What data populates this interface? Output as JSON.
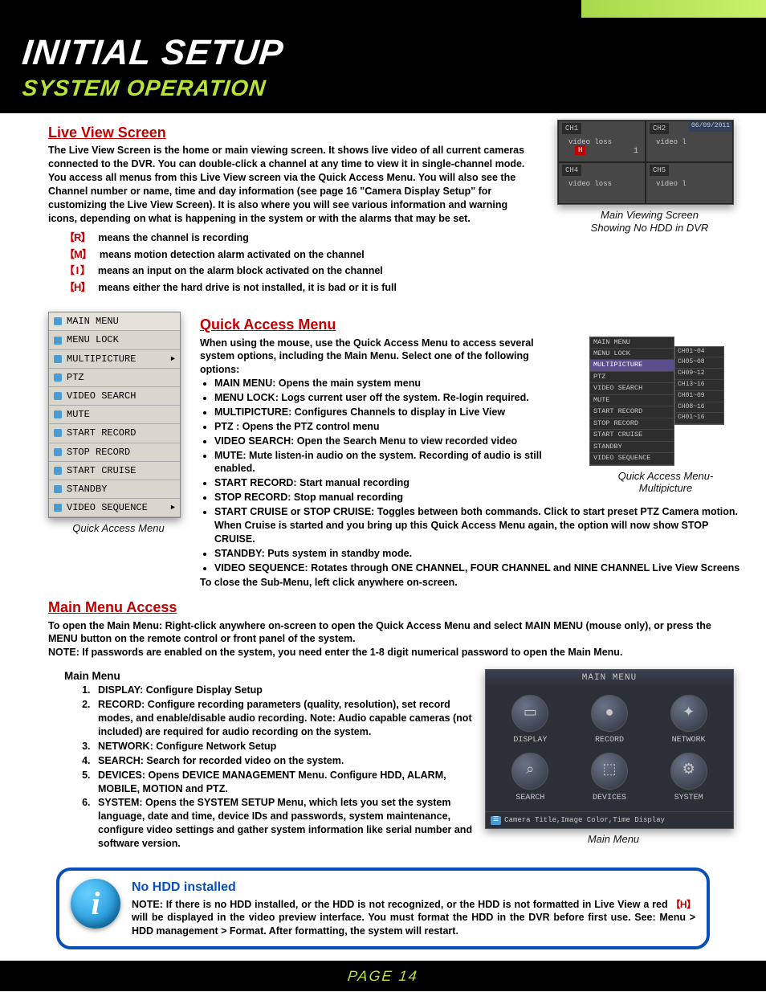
{
  "header": {
    "title": "INITIAL SETUP",
    "subtitle": "SYSTEM OPERATION"
  },
  "live_view": {
    "heading": "Live View Screen",
    "body": "The Live View Screen is the home or main viewing screen. It shows live video of all current cameras connected to the DVR. You can double-click a channel at any time to view it in single-channel mode. You access all menus from this Live View screen via the Quick Access Menu. You will also see the Channel number or name, time and day information (see page 16 \"Camera Display Setup\" for customizing the Live View Screen). It is also where you will see various information and warning icons, depending on what is happening in the system or with the alarms that may be set.",
    "icons": [
      {
        "chip": "【R】",
        "desc": "means the channel is recording"
      },
      {
        "chip": "【M】",
        "desc": "means motion detection alarm activated on the channel"
      },
      {
        "chip": "【 I 】",
        "desc": "means an input on the alarm block activated on the channel"
      },
      {
        "chip": "【H】",
        "desc": "means either the hard drive is not installed, it is bad or it is full"
      }
    ],
    "fig_caption_1": "Main Viewing Screen",
    "fig_caption_2": "Showing No HDD in DVR",
    "grid": {
      "ch1": "CH1",
      "ch2": "CH2",
      "ch4": "CH4",
      "ch5": "CH5",
      "date": "06/09/2011",
      "vloss": "video loss",
      "vl": "video l",
      "h": "H",
      "one": "1"
    }
  },
  "qam": {
    "heading": "Quick Access Menu",
    "intro": "When using the mouse, use the Quick Access Menu to access several system options, including the Main Menu. Select one of the following options:",
    "bullets": [
      "MAIN MENU: Opens the main system menu",
      "MENU LOCK: Logs current user off the system. Re-login required.",
      "MULTIPICTURE: Configures Channels to display in Live View",
      "PTZ : Opens the PTZ control menu",
      "VIDEO SEARCH: Open the Search Menu to view recorded video",
      "MUTE: Mute listen-in audio on the system. Recording of audio is still enabled.",
      "START RECORD: Start manual recording",
      "STOP RECORD: Stop manual recording",
      "START CRUISE or STOP CRUISE: Toggles between both commands. Click to start preset PTZ Camera motion. When Cruise is started and you bring up this Quick Access Menu again, the option will now show STOP CRUISE.",
      "STANDBY: Puts system in standby mode.",
      "VIDEO SEQUENCE: Rotates through ONE CHANNEL, FOUR CHANNEL and NINE CHANNEL Live View Screens"
    ],
    "outro": "To close the Sub-Menu, left click anywhere on-screen.",
    "menu_items": [
      "MAIN MENU",
      "MENU LOCK",
      "MULTIPICTURE",
      "PTZ",
      "VIDEO SEARCH",
      "MUTE",
      "START RECORD",
      "STOP RECORD",
      "START CRUISE",
      "STANDBY",
      "VIDEO SEQUENCE"
    ],
    "caption_left": "Quick Access Menu",
    "caption_right_1": "Quick Access Menu-",
    "caption_right_2": "Multipicture",
    "small_menu": [
      "MAIN MENU",
      "MENU LOCK",
      "MULTIPICTURE",
      "PTZ",
      "VIDEO SEARCH",
      "MUTE",
      "START RECORD",
      "STOP RECORD",
      "START CRUISE",
      "STANDBY",
      "VIDEO SEQUENCE"
    ],
    "sub_menu": [
      "CH01~04",
      "CH05~08",
      "CH09~12",
      "CH13~16",
      "CH01~09",
      "CH08~16",
      "CH01~16"
    ]
  },
  "mma": {
    "heading": "Main Menu Access",
    "body": "To open the Main Menu: Right-click anywhere on-screen to open the Quick Access Menu and select MAIN MENU (mouse only), or press the MENU button on the remote control or front panel of the system.",
    "note": "NOTE: If passwords are enabled on the system, you need enter the 1-8 digit numerical password to open the Main Menu."
  },
  "mainmenu": {
    "heading": "Main Menu",
    "items": [
      "DISPLAY: Configure Display Setup",
      "RECORD: Configure recording parameters (quality, resolution), set record modes, and enable/disable audio recording. Note: Audio capable cameras (not included) are required for audio recording on the system.",
      "NETWORK: Configure Network Setup",
      "SEARCH: Search for recorded video on the system.",
      "DEVICES: Opens DEVICE MANAGEMENT Menu. Configure HDD, ALARM, MOBILE, MOTION and PTZ.",
      "SYSTEM: Opens the SYSTEM SETUP Menu, which lets you set the system language, date and time, device IDs and passwords, system maintenance, configure video settings and gather system information like serial number and software version."
    ],
    "panel": {
      "title": "MAIN MENU",
      "btns": [
        "DISPLAY",
        "RECORD",
        "NETWORK",
        "SEARCH",
        "DEVICES",
        "SYSTEM"
      ],
      "footer": "Camera Title,Image Color,Time Display"
    },
    "caption": "Main Menu"
  },
  "hdd_note": {
    "heading": "No HDD installed",
    "body_pre": "NOTE: If there is no HDD installed, or the HDD is not recognized, or the HDD is not formatted  in Live View a red ",
    "chip": "【H】",
    "body_post": " will be displayed in the video preview interface. You must format the HDD in the DVR before first use. See: Menu > HDD management > Format. After formatting, the system will restart."
  },
  "footer": {
    "page": "PAGE 14"
  }
}
